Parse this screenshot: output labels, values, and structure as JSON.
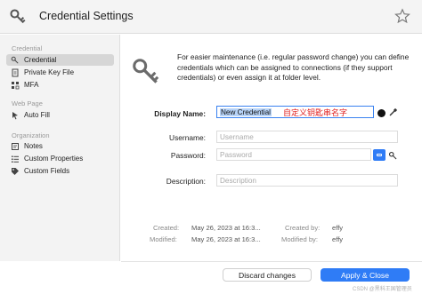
{
  "window": {
    "title": "Credential Settings",
    "icons": {
      "title": "key-icon",
      "favorite": "star-icon"
    }
  },
  "sidebar": {
    "sections": [
      {
        "title": "Credential",
        "items": [
          {
            "label": "Credential",
            "icon": "key-icon",
            "selected": true
          },
          {
            "label": "Private Key File",
            "icon": "document-icon",
            "selected": false
          },
          {
            "label": "MFA",
            "icon": "grid-icon",
            "selected": false
          }
        ]
      },
      {
        "title": "Web Page",
        "items": [
          {
            "label": "Auto Fill",
            "icon": "cursor-icon",
            "selected": false
          }
        ]
      },
      {
        "title": "Organization",
        "items": [
          {
            "label": "Notes",
            "icon": "note-icon",
            "selected": false
          },
          {
            "label": "Custom Properties",
            "icon": "list-icon",
            "selected": false
          },
          {
            "label": "Custom Fields",
            "icon": "tag-icon",
            "selected": false
          }
        ]
      }
    ]
  },
  "main": {
    "intro": "For easier maintenance (i.e. regular password change) you can define credentials which can be assigned to connections (if they support credentials) or even assign it at folder level.",
    "fields": {
      "display_name": {
        "label": "Display Name:",
        "value": "New Credential",
        "annotation": "自定义钥匙串名字"
      },
      "username": {
        "label": "Username:",
        "placeholder": "Username"
      },
      "password": {
        "label": "Password:",
        "placeholder": "Password"
      },
      "description": {
        "label": "Description:",
        "placeholder": "Description"
      }
    },
    "meta": {
      "created_label": "Created:",
      "created_value": "May 26, 2023 at 16:3...",
      "created_by_label": "Created by:",
      "created_by_value": "effy",
      "modified_label": "Modified:",
      "modified_value": "May 26, 2023 at 16:3...",
      "modified_by_label": "Modified by:",
      "modified_by_value": "effy"
    }
  },
  "footer": {
    "discard_label": "Discard changes",
    "apply_label": "Apply & Close"
  },
  "watermark": "CSDN @黑科王国管理员",
  "colors": {
    "accent": "#2f7cf6",
    "selection": "#b7d3f7",
    "annotation": "#e02020"
  }
}
